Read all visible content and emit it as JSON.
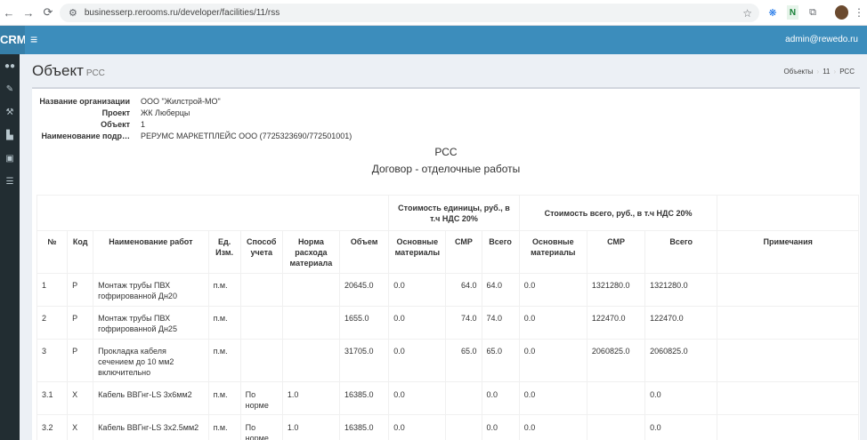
{
  "browser": {
    "back_icon": "←",
    "forward_icon": "→",
    "reload_icon": "⟳",
    "url": "businesserp.rerooms.ru/developer/facilities/11/rss"
  },
  "header": {
    "logo": "CRM",
    "menu_icon": "≡",
    "user_email": "admin@rewedo.ru"
  },
  "page": {
    "title": "Объект",
    "subtitle": "РСС",
    "breadcrumb": [
      "Объекты",
      "11",
      "РСС"
    ]
  },
  "info": {
    "org_label": "Название организации",
    "org_value": "ООО \"Жилстрой-МО\"",
    "project_label": "Проект",
    "project_value": "ЖК Люберцы",
    "object_label": "Объект",
    "object_value": "1",
    "contractor_label": "Наименование подр…",
    "contractor_value": "РЕРУМС МАРКЕТПЛЕЙС ООО (7725323690/772501001)"
  },
  "doc": {
    "title": "РСС",
    "subtitle": "Договор - отделочные работы"
  },
  "table": {
    "group_unit": "Стоимость единицы, руб., в т.ч НДС 20%",
    "group_total": "Стоимость всего, руб., в т.ч НДС 20%",
    "headers": {
      "num": "№",
      "code": "Код",
      "name": "Наименование работ",
      "unit": "Ед. Изм.",
      "method": "Способ учета",
      "norm": "Норма расхода материала",
      "volume": "Объем",
      "u_materials": "Основные материалы",
      "u_smr": "СМР",
      "u_total": "Всего",
      "t_materials": "Основные материалы",
      "t_smr": "СМР",
      "t_total": "Всего",
      "notes": "Примечания"
    },
    "rows": [
      {
        "num": "1",
        "code": "Р",
        "name": "Монтаж трубы ПВХ гофрированной Дн20",
        "unit": "п.м.",
        "method": "",
        "norm": "",
        "volume": "20645.0",
        "u_mat": "0.0",
        "u_smr": "64.0",
        "u_total": "64.0",
        "t_mat": "0.0",
        "t_smr": "1321280.0",
        "t_total": "1321280.0",
        "notes": ""
      },
      {
        "num": "2",
        "code": "Р",
        "name": "Монтаж трубы ПВХ гофрированной Дн25",
        "unit": "п.м.",
        "method": "",
        "norm": "",
        "volume": "1655.0",
        "u_mat": "0.0",
        "u_smr": "74.0",
        "u_total": "74.0",
        "t_mat": "0.0",
        "t_smr": "122470.0",
        "t_total": "122470.0",
        "notes": ""
      },
      {
        "num": "3",
        "code": "Р",
        "name": "Прокладка кабеля сечением до 10 мм2 включительно",
        "unit": "п.м.",
        "method": "",
        "norm": "",
        "volume": "31705.0",
        "u_mat": "0.0",
        "u_smr": "65.0",
        "u_total": "65.0",
        "t_mat": "0.0",
        "t_smr": "2060825.0",
        "t_total": "2060825.0",
        "notes": ""
      },
      {
        "num": "3.1",
        "code": "Х",
        "name": "Кабель ВВГнг-LS 3х6мм2",
        "unit": "п.м.",
        "method": "По норме",
        "norm": "1.0",
        "volume": "16385.0",
        "u_mat": "0.0",
        "u_smr": "",
        "u_total": "0.0",
        "t_mat": "0.0",
        "t_smr": "",
        "t_total": "0.0",
        "notes": ""
      },
      {
        "num": "3.2",
        "code": "Х",
        "name": "Кабель ВВГнг-LS 3х2.5мм2",
        "unit": "п.м.",
        "method": "По норме",
        "norm": "1.0",
        "volume": "16385.0",
        "u_mat": "0.0",
        "u_smr": "",
        "u_total": "0.0",
        "t_mat": "0.0",
        "t_smr": "",
        "t_total": "0.0",
        "notes": ""
      }
    ]
  }
}
